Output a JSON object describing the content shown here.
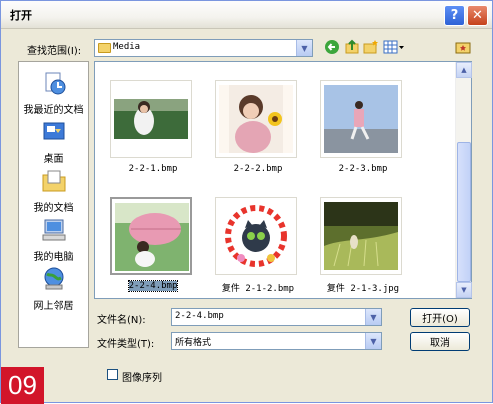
{
  "window": {
    "title": "打开",
    "help_symbol": "?",
    "close_symbol": "✕"
  },
  "lookin": {
    "label": "查找范围(I):",
    "value": "Media"
  },
  "places": [
    {
      "label": "我最近的文档"
    },
    {
      "label": "桌面"
    },
    {
      "label": "我的文档"
    },
    {
      "label": "我的电脑"
    },
    {
      "label": "网上邻居"
    }
  ],
  "files": [
    {
      "name": "2-2-1.bmp"
    },
    {
      "name": "2-2-2.bmp"
    },
    {
      "name": "2-2-3.bmp"
    },
    {
      "name": "2-2-4.bmp"
    },
    {
      "name": "复件 2-1-2.bmp"
    },
    {
      "name": "复件 2-1-3.jpg"
    }
  ],
  "filename": {
    "label": "文件名(N):",
    "value": "2-2-4.bmp"
  },
  "filetype": {
    "label": "文件类型(T):",
    "value": "所有格式"
  },
  "buttons": {
    "open": "打开(O)",
    "cancel": "取消"
  },
  "sequence_checkbox": {
    "label": "图像序列"
  },
  "badge": {
    "text": "09"
  }
}
